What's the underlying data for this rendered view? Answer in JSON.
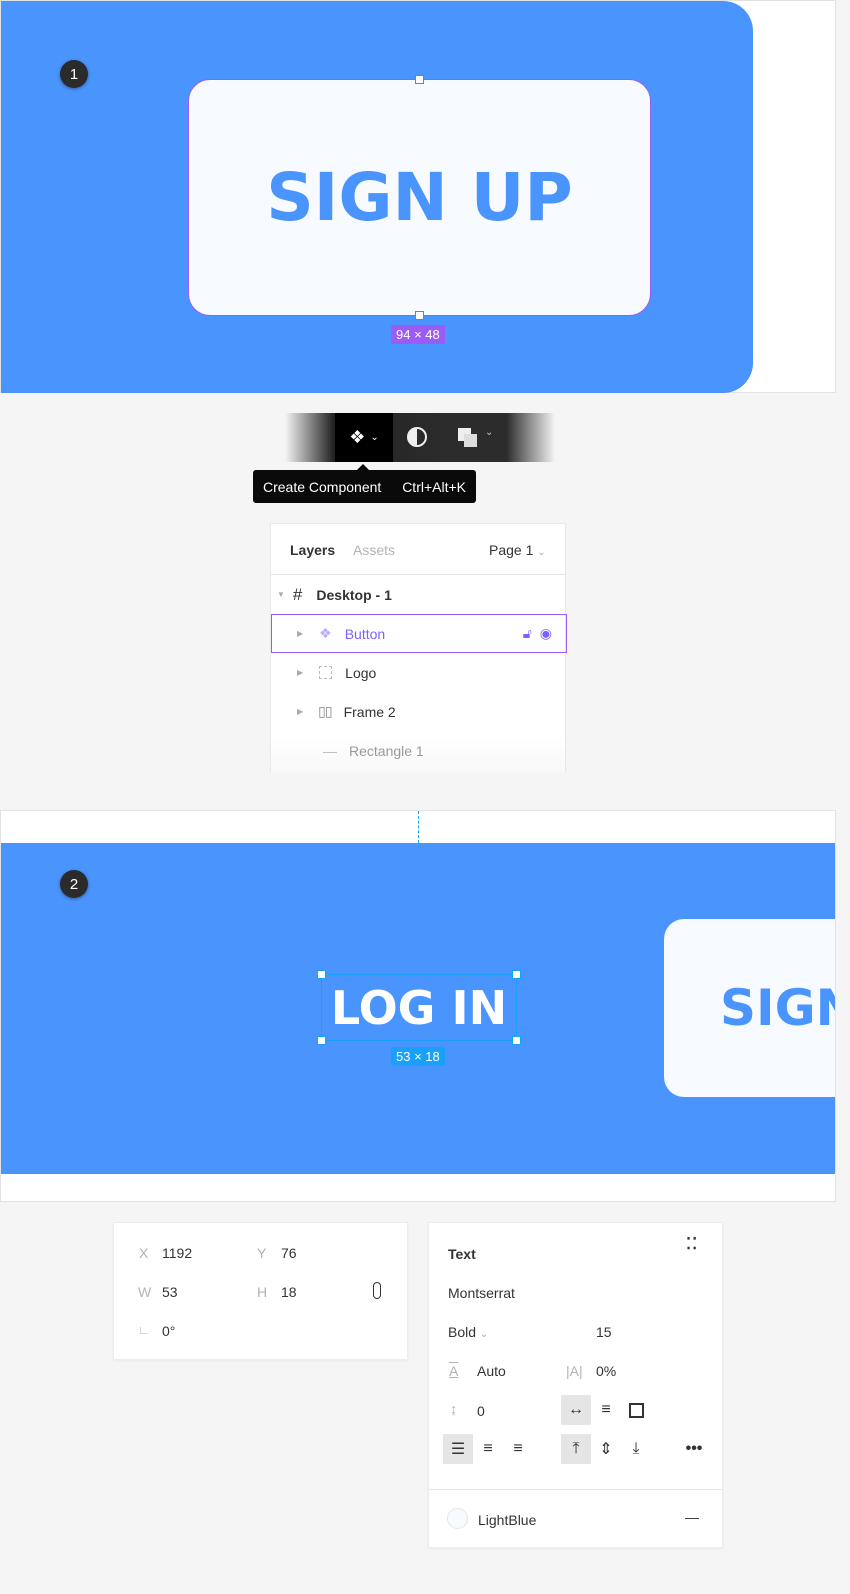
{
  "step1": {
    "badge": "1",
    "button_text": "SIGN UP",
    "dimensions": "94 × 48"
  },
  "toolbar": {
    "icons": [
      "component-icon",
      "chevron-down-icon",
      "mask-icon",
      "boolean-icon",
      "chevron-down-icon"
    ],
    "tooltip_label": "Create Component",
    "tooltip_shortcut": "Ctrl+Alt+K"
  },
  "layers_panel": {
    "tabs": [
      "Layers",
      "Assets"
    ],
    "page": "Page 1",
    "frame": "Desktop - 1",
    "items": [
      {
        "label": "Button",
        "selected": true
      },
      {
        "label": "Logo"
      },
      {
        "label": "Frame 2"
      },
      {
        "label": "Rectangle 1"
      }
    ]
  },
  "step2": {
    "badge": "2",
    "text": "LOG IN",
    "dimensions": "53 × 18",
    "partial_button_text": "SIGN UP"
  },
  "transform": {
    "x_label": "X",
    "x": "1192",
    "y_label": "Y",
    "y": "76",
    "w_label": "W",
    "w": "53",
    "h_label": "H",
    "h": "18",
    "rotation": "0°"
  },
  "text_panel": {
    "title": "Text",
    "font": "Montserrat",
    "weight": "Bold",
    "size": "15",
    "line_height": "Auto",
    "letter_spacing": "0%",
    "paragraph_spacing": "0",
    "fill_name": "LightBlue"
  },
  "colors": {
    "canvas_blue": "#4a94fd",
    "card": "#f7fafe",
    "selection_purple": "#9a5cf5",
    "selection_blue": "#18a0fb"
  }
}
